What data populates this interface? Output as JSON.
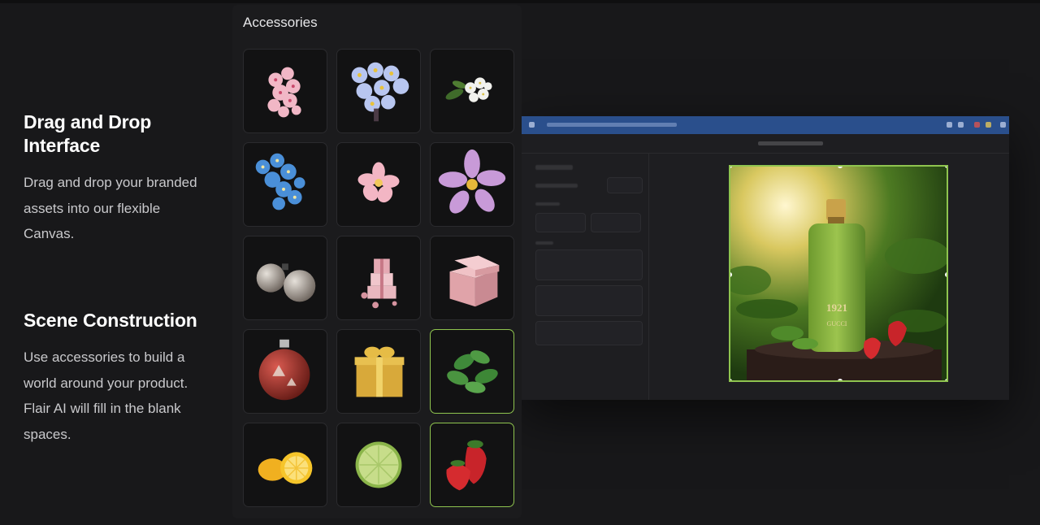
{
  "features": [
    {
      "title": "Drag and Drop Interface",
      "description": "Drag and drop your branded assets into our flexible Canvas."
    },
    {
      "title": "Scene Construction",
      "description": "Use accessories to build a world around your product. Flair AI will fill in the blank spaces."
    }
  ],
  "panel": {
    "title": "Accessories",
    "items": [
      {
        "name": "pink-cherry-blossoms",
        "selected": false
      },
      {
        "name": "blue-flower-cluster",
        "selected": false
      },
      {
        "name": "white-blossoms",
        "selected": false
      },
      {
        "name": "blue-forget-me-nots",
        "selected": false
      },
      {
        "name": "plumeria-flower",
        "selected": false
      },
      {
        "name": "purple-cosmos-flower",
        "selected": false
      },
      {
        "name": "silver-ornaments",
        "selected": false
      },
      {
        "name": "pink-gift-stack",
        "selected": false
      },
      {
        "name": "pink-gift-box",
        "selected": false
      },
      {
        "name": "red-ornament",
        "selected": false
      },
      {
        "name": "gold-gift-box",
        "selected": false
      },
      {
        "name": "mint-leaves",
        "selected": true
      },
      {
        "name": "lemon-slices",
        "selected": false
      },
      {
        "name": "lime-slice",
        "selected": false
      },
      {
        "name": "strawberries",
        "selected": true
      }
    ]
  },
  "editor": {
    "product_label": "1921",
    "product_brand": "GUCCI"
  },
  "colors": {
    "background": "#18181a",
    "panel": "#1b1b1d",
    "accent": "#8fc44f",
    "browser_bar": "#2a4f8c"
  }
}
